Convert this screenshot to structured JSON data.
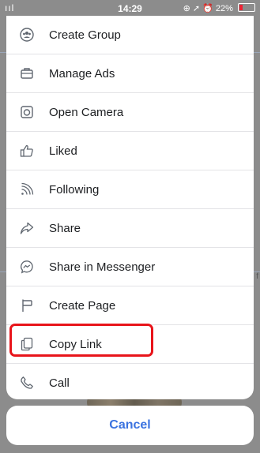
{
  "status_bar": {
    "signal": "ııl",
    "time": "14:29",
    "indicators": "⊕ ➚ ⏰",
    "battery": "22%"
  },
  "menu": {
    "items": [
      {
        "label": "Create Group",
        "icon": "group-icon"
      },
      {
        "label": "Manage Ads",
        "icon": "briefcase-icon"
      },
      {
        "label": "Open Camera",
        "icon": "camera-icon"
      },
      {
        "label": "Liked",
        "icon": "thumbs-up-icon"
      },
      {
        "label": "Following",
        "icon": "rss-icon"
      },
      {
        "label": "Share",
        "icon": "share-arrow-icon"
      },
      {
        "label": "Share in Messenger",
        "icon": "messenger-icon"
      },
      {
        "label": "Create Page",
        "icon": "flag-icon"
      },
      {
        "label": "Copy Link",
        "icon": "copy-icon",
        "highlighted": true
      },
      {
        "label": "Call",
        "icon": "phone-icon"
      }
    ]
  },
  "cancel_label": "Cancel",
  "background_snippet": "f",
  "colors": {
    "accent": "#3b73e0",
    "highlight": "#e8141a",
    "icon": "#606770"
  }
}
